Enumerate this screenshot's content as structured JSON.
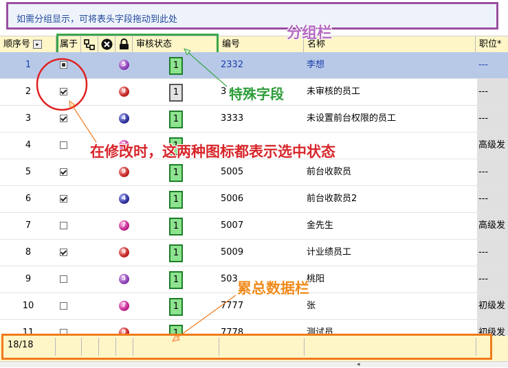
{
  "group_panel": {
    "hint": "如需分组显示，可将表头字段拖动到此处"
  },
  "header": {
    "seq": "顺序号",
    "belong": "属于",
    "status": "审核状态",
    "number": "编号",
    "name": "名称",
    "position": "职位*"
  },
  "rows": [
    {
      "seq": "1",
      "check": "square",
      "ball": "purple",
      "ball_num": "5",
      "status": "1",
      "status_style": "green",
      "number": "2332",
      "name": "李想",
      "position": "---",
      "selected": true
    },
    {
      "seq": "2",
      "check": "on",
      "ball": "red",
      "ball_num": "9",
      "status": "1",
      "status_style": "grey",
      "number": "3",
      "name": "未审核的员工",
      "position": "---"
    },
    {
      "seq": "3",
      "check": "on",
      "ball": "blue",
      "ball_num": "4",
      "status": "1",
      "status_style": "green",
      "number": "3333",
      "name": "未设置前台权限的员工",
      "position": "---"
    },
    {
      "seq": "4",
      "check": "off",
      "ball": "magenta",
      "ball_num": "7",
      "status": "1",
      "status_style": "green",
      "number": "",
      "name": "",
      "position": "高级发"
    },
    {
      "seq": "5",
      "check": "on",
      "ball": "red",
      "ball_num": "9",
      "status": "1",
      "status_style": "green",
      "number": "5005",
      "name": "前台收款员",
      "position": "---"
    },
    {
      "seq": "6",
      "check": "on",
      "ball": "blue",
      "ball_num": "4",
      "status": "1",
      "status_style": "green",
      "number": "5006",
      "name": "前台收款员2",
      "position": "---"
    },
    {
      "seq": "7",
      "check": "off",
      "ball": "magenta",
      "ball_num": "7",
      "status": "1",
      "status_style": "green",
      "number": "5007",
      "name": "金先生",
      "position": "高级发"
    },
    {
      "seq": "8",
      "check": "on",
      "ball": "red",
      "ball_num": "9",
      "status": "1",
      "status_style": "green",
      "number": "5009",
      "name": "计业绩员工",
      "position": "---"
    },
    {
      "seq": "9",
      "check": "off",
      "ball": "purple",
      "ball_num": "5",
      "status": "1",
      "status_style": "green",
      "number": "503",
      "name": "桃阳",
      "position": "---"
    },
    {
      "seq": "10",
      "check": "off",
      "ball": "magenta",
      "ball_num": "7",
      "status": "1",
      "status_style": "green",
      "number": "7777",
      "name": "张",
      "position": "初级发"
    },
    {
      "seq": "11",
      "check": "off",
      "ball": "red",
      "ball_num": "9",
      "status": "1",
      "status_style": "green",
      "number": "7778",
      "name": "测试员",
      "position": "初级发"
    }
  ],
  "footer": {
    "count": "18/18"
  },
  "annotations": {
    "group_bar": "分组栏",
    "special_field": "特殊字段",
    "modify_note": "在修改时，这两种图标都表示选中状态",
    "summary_bar": "累总数据栏"
  },
  "colors": {
    "group_box": "#9a4ea0",
    "special_box": "#3aa64a",
    "modify_note": "#d8262b",
    "summary_box": "#f07a1b",
    "selected_row": "#b8c9e8",
    "header_bg": "#fff6c8"
  }
}
